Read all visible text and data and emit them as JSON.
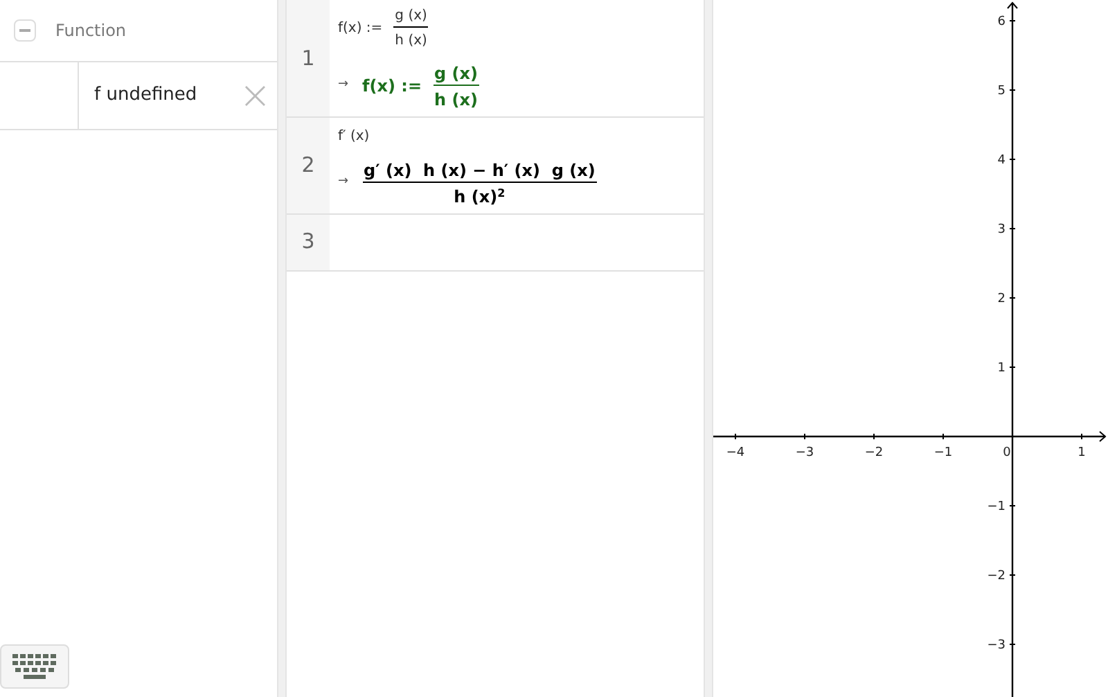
{
  "algebra": {
    "header": {
      "label": "Function",
      "expanded": true
    },
    "items": [
      {
        "text": "f undefined",
        "close": "×"
      }
    ]
  },
  "cas": {
    "rows": [
      {
        "number": "1",
        "input": {
          "kind": "fraction",
          "lhs": "f(x) :=",
          "num": "g (x)",
          "den": "h (x)"
        },
        "arrow": "→",
        "output": {
          "kind": "fraction",
          "lhs": "f(x) :=",
          "num": "g (x)",
          "den": "h (x)",
          "color": "#1d6f1d"
        }
      },
      {
        "number": "2",
        "input": {
          "kind": "text",
          "text": "f′ (x)"
        },
        "arrow": "→",
        "output": {
          "kind": "fraction",
          "num": "g′ (x)  h (x) − h′ (x)  g (x)",
          "den": "h (x)$^{2}$",
          "color": "#000000"
        }
      },
      {
        "number": "3"
      }
    ]
  },
  "graphics": {
    "chart_data": {
      "type": "line",
      "xlim": [
        -4.32,
        1.38
      ],
      "ylim": [
        -3.76,
        6.3
      ],
      "xticks": [
        {
          "value": -4,
          "label": "−4"
        },
        {
          "value": -3,
          "label": "−3"
        },
        {
          "value": -2,
          "label": "−2"
        },
        {
          "value": -1,
          "label": "−1"
        },
        {
          "value": 0,
          "label": "0"
        },
        {
          "value": 1,
          "label": "1"
        }
      ],
      "yticks": [
        {
          "value": -3,
          "label": "−3"
        },
        {
          "value": -2,
          "label": "−2"
        },
        {
          "value": -1,
          "label": "−1"
        },
        {
          "value": 1,
          "label": "1"
        },
        {
          "value": 2,
          "label": "2"
        },
        {
          "value": 3,
          "label": "3"
        },
        {
          "value": 4,
          "label": "4"
        },
        {
          "value": 5,
          "label": "5"
        },
        {
          "value": 6,
          "label": "6"
        }
      ]
    }
  }
}
